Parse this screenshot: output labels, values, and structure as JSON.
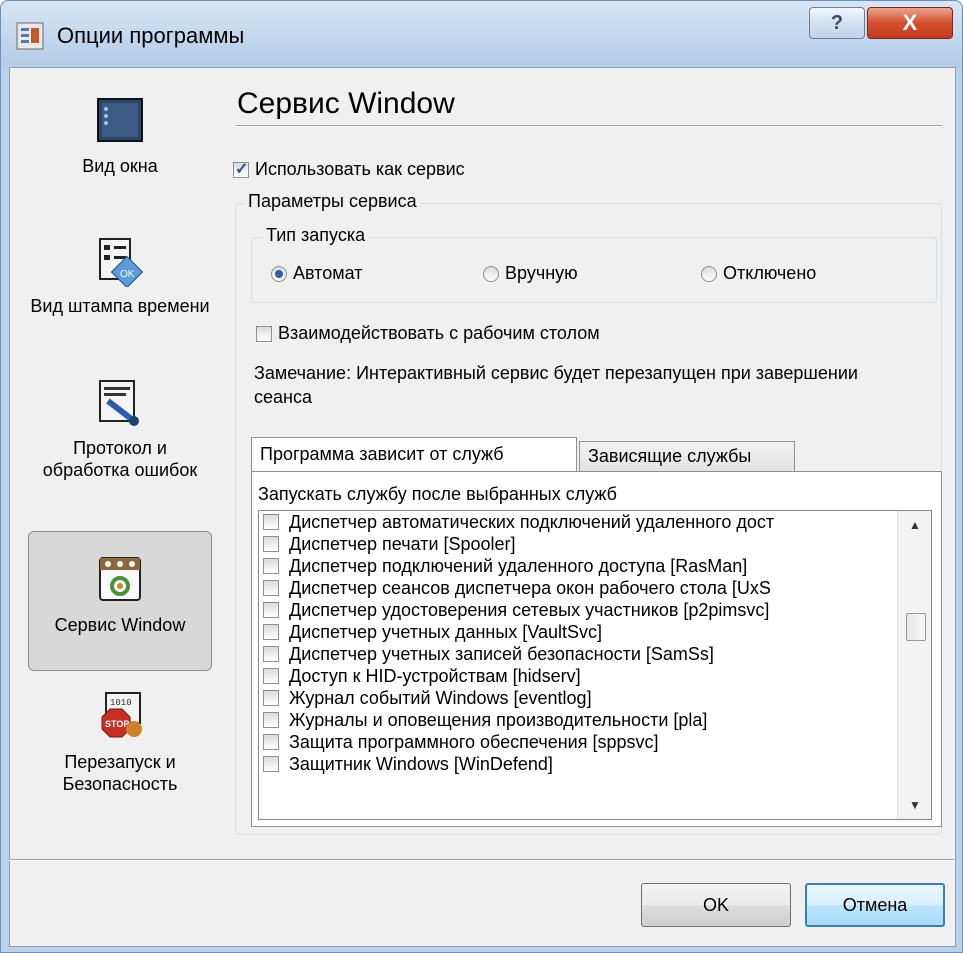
{
  "window": {
    "title": "Опции программы",
    "help_label": "?",
    "close_label": "X"
  },
  "sidebar": {
    "items": [
      {
        "label": "Вид окна",
        "icon": "window-view-icon"
      },
      {
        "label": "Вид штампа времени",
        "icon": "timestamp-icon"
      },
      {
        "label": "Протокол и обработка ошибок",
        "icon": "error-log-icon"
      },
      {
        "label": "Сервис Window",
        "icon": "service-icon",
        "selected": true
      },
      {
        "label": "Перезапуск и Безопасность",
        "icon": "restart-security-icon"
      }
    ]
  },
  "main": {
    "section_title": "Сервис Window",
    "use_as_service": {
      "label": "Использовать как сервис",
      "checked": true
    },
    "service_params": {
      "legend": "Параметры сервиса",
      "startup_type": {
        "legend": "Тип запуска",
        "options": [
          {
            "label": "Автомат",
            "selected": true
          },
          {
            "label": "Вручную",
            "selected": false
          },
          {
            "label": "Отключено",
            "selected": false
          }
        ]
      },
      "interact_desktop": {
        "label": "Взаимодействовать с рабочим столом",
        "checked": false
      },
      "note": "Замечание: Интерактивный сервис будет перезапущен при завершении сеанса"
    },
    "tabs": [
      {
        "label": "Программа зависит от служб",
        "active": true
      },
      {
        "label": "Зависящие службы",
        "active": false
      }
    ],
    "panel_caption": "Запускать службу после выбранных служб",
    "services": [
      "Диспетчер автоматических подключений удаленного дост",
      "Диспетчер печати [Spooler]",
      "Диспетчер подключений удаленного доступа [RasMan]",
      "Диспетчер сеансов диспетчера окон рабочего стола [UxS",
      "Диспетчер удостоверения сетевых участников [p2pimsvc]",
      "Диспетчер учетных данных [VaultSvc]",
      "Диспетчер учетных записей безопасности [SamSs]",
      "Доступ к HID-устройствам [hidserv]",
      "Журнал событий Windows [eventlog]",
      "Журналы и оповещения производительности [pla]",
      "Защита программного обеспечения [sppsvc]",
      "Защитник Windows [WinDefend]"
    ]
  },
  "footer": {
    "ok_label": "OK",
    "cancel_label": "Отмена"
  },
  "colors": {
    "title_gradient": "#c2d7ee",
    "close_red": "#d5502f",
    "client_bg": "#f0f0f0",
    "radio_dot": "#2f5fa8"
  }
}
